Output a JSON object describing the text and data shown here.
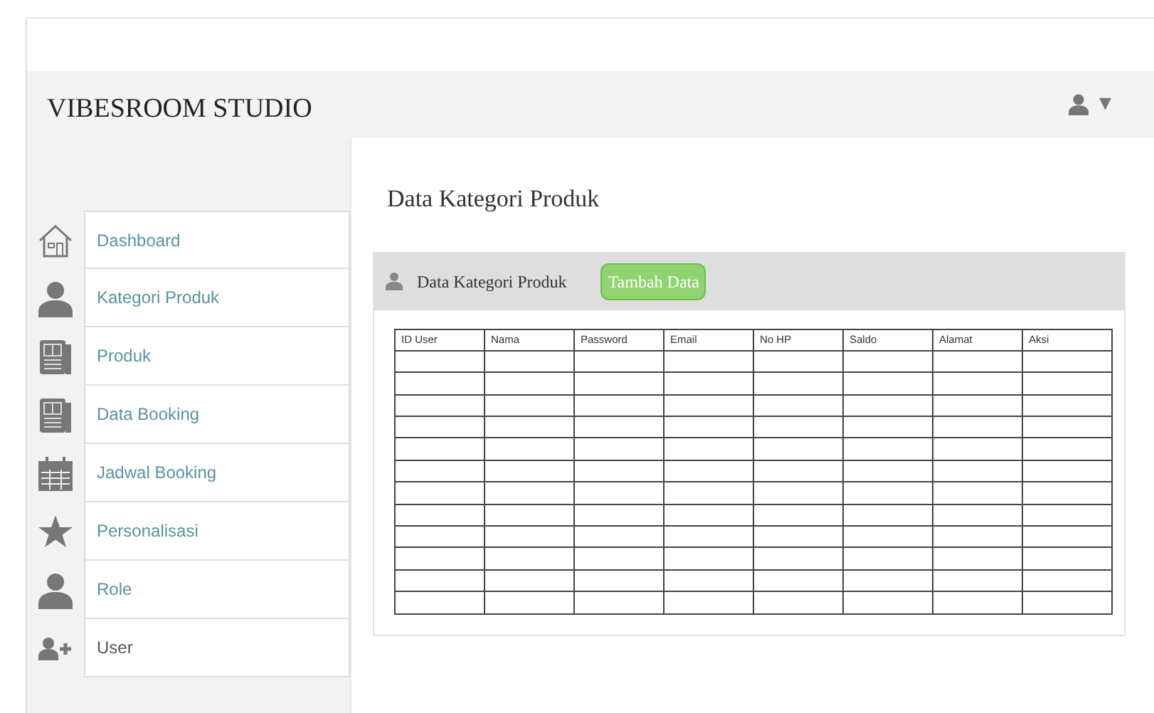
{
  "navbar": {
    "brand": "VIBESROOM STUDIO",
    "user_menu": {
      "caret": "▼"
    }
  },
  "sidebar": {
    "items": [
      {
        "label": "Dashboard",
        "kind": "home",
        "selected": false
      },
      {
        "label": "Kategori Produk",
        "kind": "person",
        "selected": false
      },
      {
        "label": "Produk",
        "kind": "document",
        "selected": false
      },
      {
        "label": "Data Booking",
        "kind": "document",
        "selected": false
      },
      {
        "label": "Jadwal Booking",
        "kind": "calendar",
        "selected": false
      },
      {
        "label": "Personalisasi",
        "kind": "star",
        "selected": false
      },
      {
        "label": "Role",
        "kind": "person",
        "selected": false
      },
      {
        "label": "User",
        "kind": "personadd",
        "selected": true
      }
    ]
  },
  "page_title": "Data Kategori Produk",
  "card": {
    "header": "Data Kategori Produk",
    "add_button": "Tambah Data",
    "table": {
      "columns": [
        "ID User",
        "Nama",
        "Password",
        "Email",
        "No HP",
        "Saldo",
        "Alamat",
        "Aksi"
      ]
    }
  }
}
